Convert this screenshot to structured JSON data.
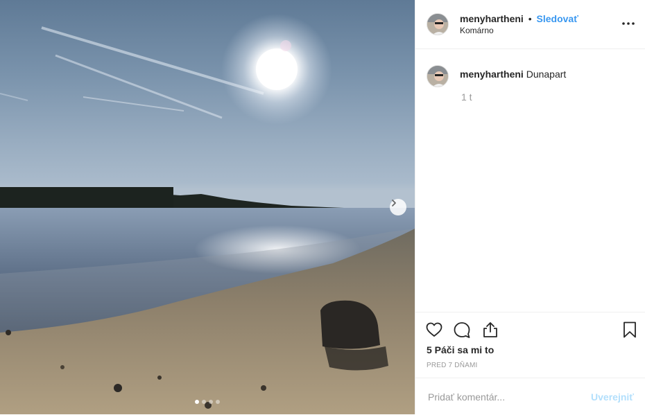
{
  "post": {
    "username": "menyhartheni",
    "follow_label": "Sledovať",
    "separator": "•",
    "location": "Komárno",
    "caption_user": "menyhartheni",
    "caption_text": "Dunapart",
    "caption_age": "1 t",
    "likes_text": "5 Páči sa mi to",
    "date_text": "PRED 7 DŇAMI",
    "comment_placeholder": "Pridať komentár...",
    "post_label": "Uverejniť"
  },
  "carousel": {
    "total_slides": 4,
    "active_slide": 1
  },
  "colors": {
    "accent": "#3897f0",
    "post_disabled": "#b2dffc",
    "text": "#262626",
    "muted": "#999999"
  },
  "icons": [
    "heart-icon",
    "comment-icon",
    "share-icon",
    "bookmark-icon",
    "more-icon",
    "chevron-right-icon"
  ]
}
